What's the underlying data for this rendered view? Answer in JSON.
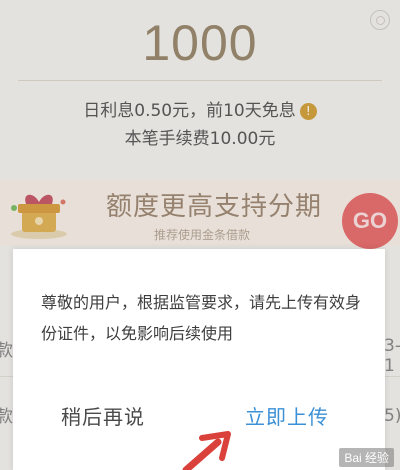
{
  "loan": {
    "amount": "1000",
    "interest_text": "日利息0.50元，前10天免息",
    "info_icon_glyph": "!",
    "fee_text": "本笔手续费10.00元"
  },
  "promo": {
    "title": "额度更高支持分期",
    "subtitle": "推荐使用金条借款",
    "go_label": "GO"
  },
  "rows": [
    {
      "left_fragment": "款",
      "right_fragment": "3-1"
    },
    {
      "left_fragment": "款",
      "right_fragment": "5)"
    }
  ],
  "dialog": {
    "message": "尊敬的用户，根据监管要求，请先上传有效身份证件，以免影响后续使用",
    "later_label": "稍后再说",
    "upload_label": "立即上传"
  },
  "watermark": {
    "text": "Bai 经验"
  },
  "colors": {
    "upload_blue": "#3c90d6",
    "go_red": "#e76f6f",
    "amount_gold": "#9a8a6f",
    "arrow_red": "#d9413a"
  }
}
